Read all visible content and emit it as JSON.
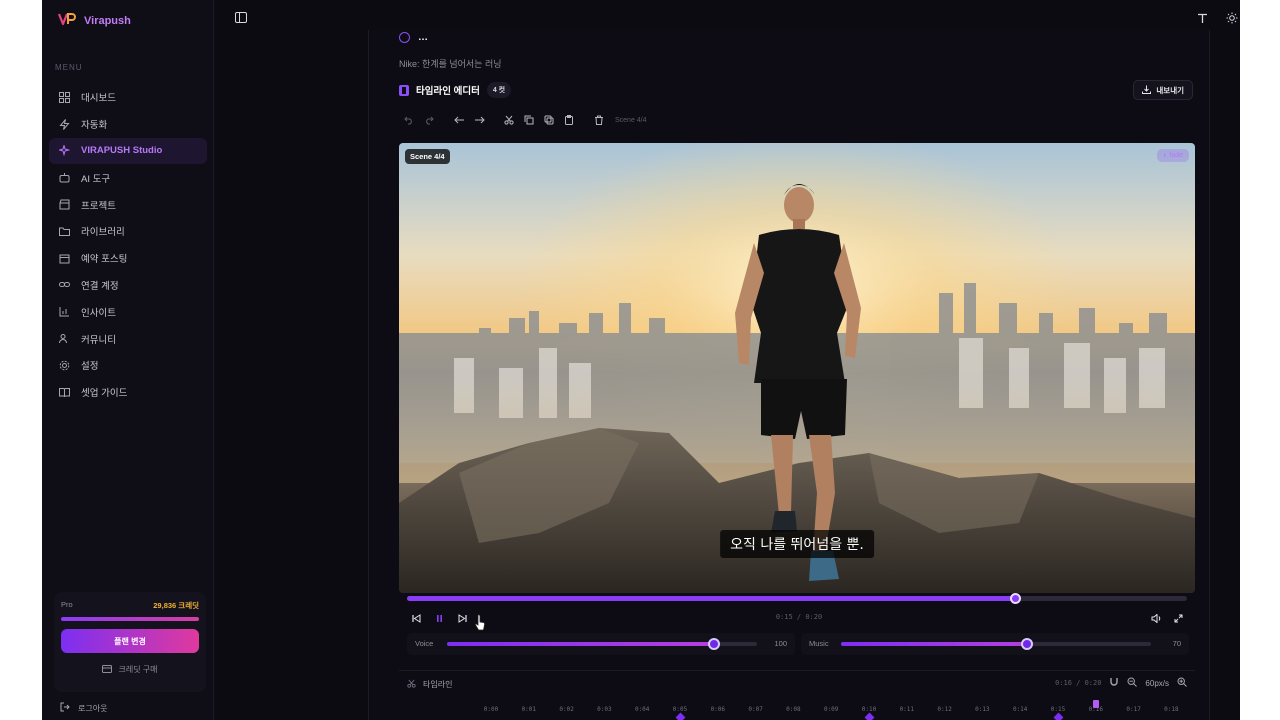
{
  "brand": {
    "name": "Virapush"
  },
  "sidebar": {
    "menu_label": "MENU",
    "items": [
      {
        "label": "대시보드",
        "icon": "grid-icon",
        "active": false
      },
      {
        "label": "자동화",
        "icon": "bolt-icon",
        "active": false
      },
      {
        "label": "VIRAPUSH Studio",
        "icon": "sparkle-icon",
        "active": true
      },
      {
        "label": "AI 도구",
        "icon": "robot-icon",
        "active": false
      },
      {
        "label": "프로젝트",
        "icon": "clapper-icon",
        "active": false
      },
      {
        "label": "라이브러리",
        "icon": "folder-icon",
        "active": false
      },
      {
        "label": "예약 포스팅",
        "icon": "calendar-icon",
        "active": false
      },
      {
        "label": "연결 계정",
        "icon": "link-icon",
        "active": false
      },
      {
        "label": "인사이트",
        "icon": "bar-chart-icon",
        "active": false
      },
      {
        "label": "커뮤니티",
        "icon": "users-icon",
        "active": false
      },
      {
        "label": "설정",
        "icon": "gear-icon",
        "active": false
      },
      {
        "label": "셋업 가이드",
        "icon": "book-icon",
        "active": false
      }
    ],
    "plan": {
      "tier": "Pro",
      "credits": "29,836 크레딧",
      "usage_fraction": 1.0,
      "change_plan_label": "플랜 변경",
      "buy_credits_label": "크레딧 구매"
    },
    "logout_label": "로그아웃"
  },
  "main": {
    "cut_title": "…",
    "subtitle": "Nike: 한계를 넘어서는 러닝",
    "editor_title": "타임라인 에디터",
    "cut_count": "4 컷",
    "export_label": "내보내기",
    "toolbar_scene_label": "Scene 4/4",
    "scene_badge": "Scene 4/4",
    "transition_badge": "fade",
    "caption": "오직 나를 뛰어넘을 뿐.",
    "time_display": "0:15 / 0:20",
    "playback_fraction": 0.78,
    "mixer": {
      "voice": {
        "label": "Voice",
        "value": 100,
        "fraction": 0.86
      },
      "music": {
        "label": "Music",
        "value": 70,
        "fraction": 0.6
      }
    },
    "timeline": {
      "label": "타임라인",
      "time": "0:16 / 0:20",
      "zoom": "60px/s",
      "ticks": [
        "0:00",
        "0:01",
        "0:02",
        "0:03",
        "0:04",
        "0:05",
        "0:06",
        "0:07",
        "0:08",
        "0:09",
        "0:10",
        "0:11",
        "0:12",
        "0:13",
        "0:14",
        "0:15",
        "0:16",
        "0:17",
        "0:18"
      ],
      "playhead_seconds": 16,
      "keyframe_seconds": [
        5,
        10,
        15
      ]
    }
  },
  "colors": {
    "accent": "#8b3cf7",
    "accent_pink": "#e0399e",
    "credits": "#f2b233"
  }
}
